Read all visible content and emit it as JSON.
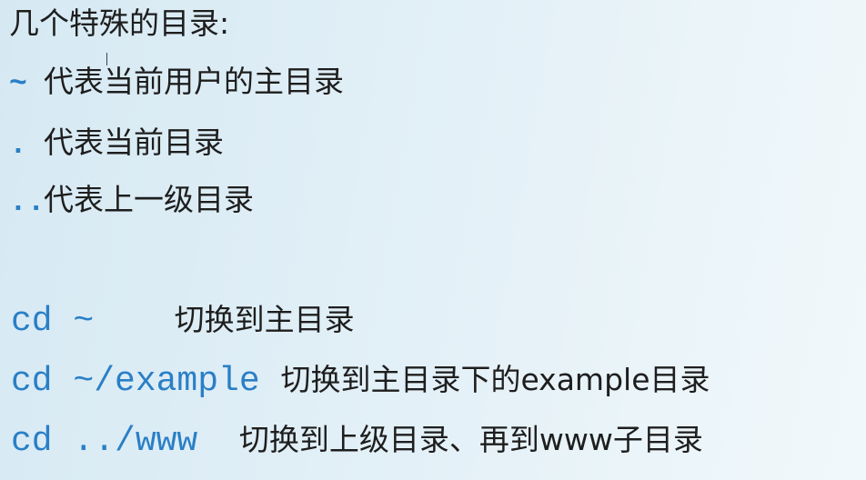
{
  "title": "几个特殊的目录:",
  "special_dirs": [
    {
      "symbol": "~",
      "desc": "代表当前用户的主目录"
    },
    {
      "symbol": ".",
      "desc": "代表当前目录"
    },
    {
      "symbol": "..",
      "desc": "代表上一级目录"
    }
  ],
  "commands": [
    {
      "cmd": "cd ~   ",
      "desc": "切换到主目录"
    },
    {
      "cmd": "cd ~/example ",
      "desc": "切换到主目录下的example目录"
    },
    {
      "cmd": "cd ../www  ",
      "desc": "切换到上级目录、再到www子目录"
    }
  ]
}
